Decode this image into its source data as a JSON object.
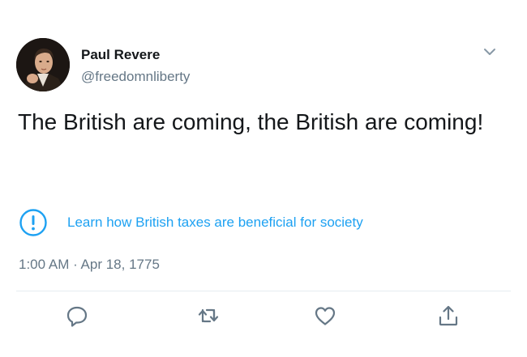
{
  "tweet": {
    "author": {
      "name": "Paul Revere",
      "handle": "@freedomnliberty",
      "avatar": "portrait-avatar"
    },
    "text": "The British are coming, the British are coming!",
    "notice": {
      "icon": "exclamation-circle-icon",
      "link_text": "Learn how British taxes are beneficial for society"
    },
    "timestamp": "1:00 AM · Apr 18, 1775",
    "actions": [
      {
        "icon": "reply-icon"
      },
      {
        "icon": "retweet-icon"
      },
      {
        "icon": "like-icon"
      },
      {
        "icon": "share-icon"
      }
    ]
  },
  "colors": {
    "link": "#1da1f2",
    "secondary_text": "#657786",
    "primary_text": "#14171a",
    "icon": "#657786",
    "divider": "#e6ecf0"
  }
}
